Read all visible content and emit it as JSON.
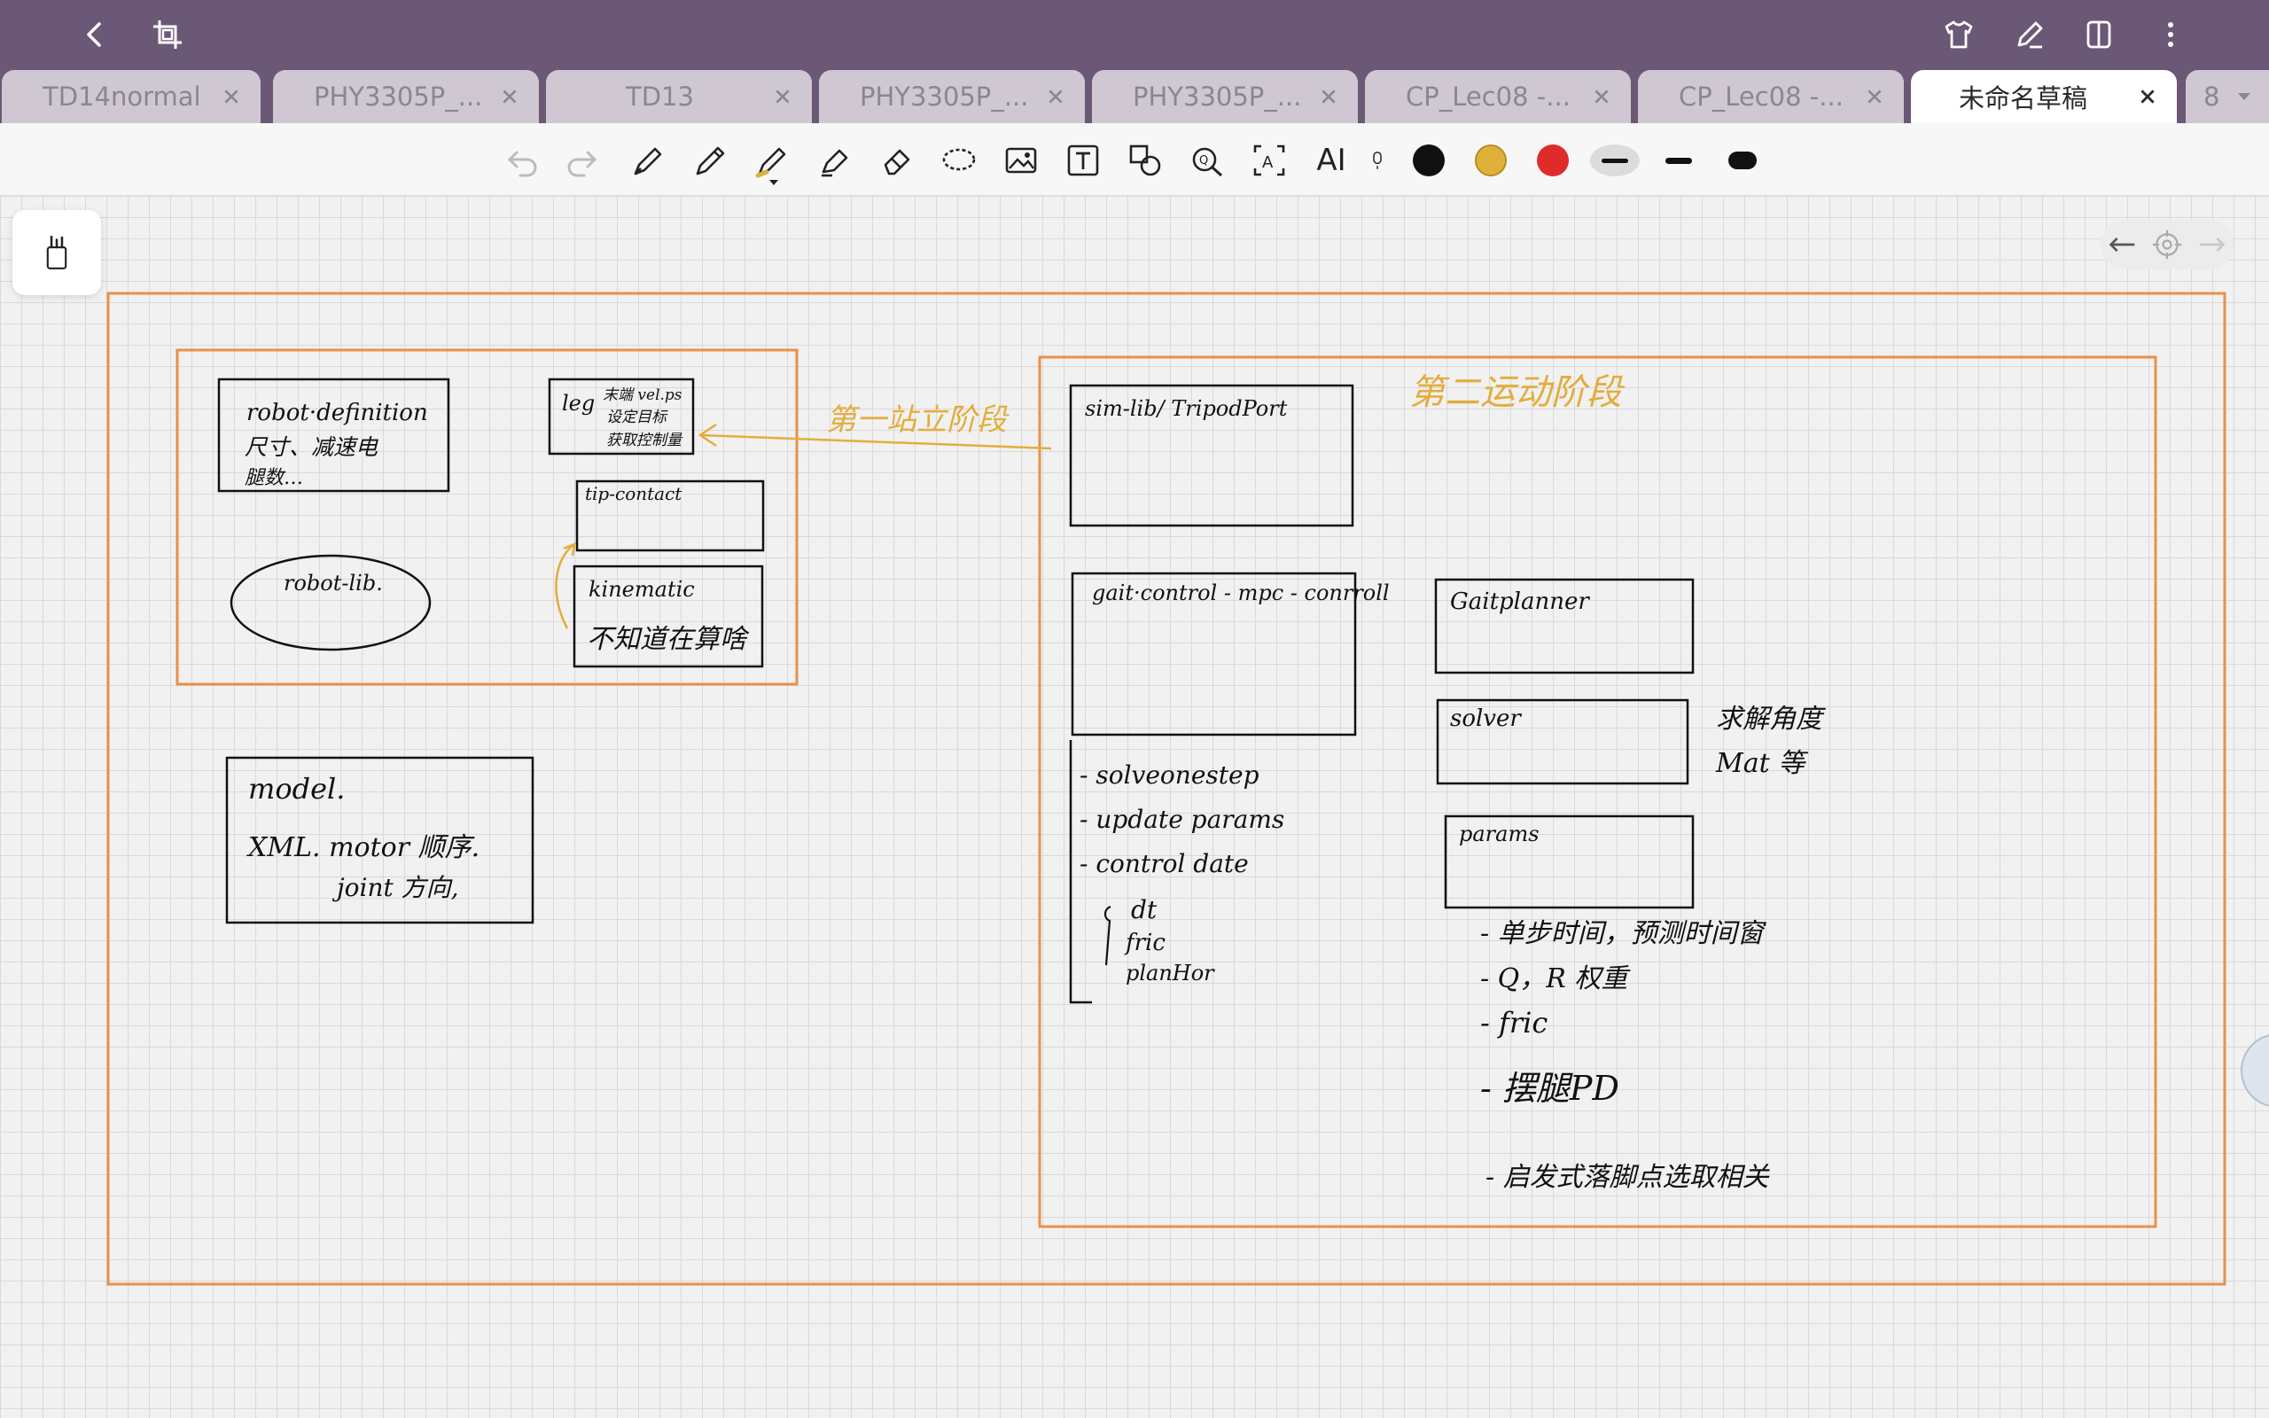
{
  "tabs": [
    {
      "label": "TD14normal",
      "active": false
    },
    {
      "label": "PHY3305P_...",
      "active": false
    },
    {
      "label": "TD13",
      "active": false
    },
    {
      "label": "PHY3305P_...",
      "active": false
    },
    {
      "label": "PHY3305P_...",
      "active": false
    },
    {
      "label": "CP_Lec08 -...",
      "active": false
    },
    {
      "label": "CP_Lec08 -...",
      "active": false
    },
    {
      "label": "未命名草稿",
      "active": true
    }
  ],
  "tab_overflow": "8",
  "colors": {
    "titlebar": "#6b5876",
    "frame_orange": "#e8914a",
    "annotation_yellow": "#e3ad3c",
    "swatch_black": "#111111",
    "swatch_gold": "#e0b13a",
    "swatch_red": "#e02b2b"
  },
  "icons": {
    "back": "chevron-left-icon",
    "crop": "crop-icon",
    "shirt": "shirt-icon",
    "pen": "pen-edit-icon",
    "layout": "layout-icon",
    "more": "more-vertical-icon"
  },
  "toolbar": {
    "ai_label": "AI"
  },
  "notes": {
    "robot_definition": [
      "robot·definition",
      "尺寸、减速电",
      "腿数…"
    ],
    "leg_box": [
      "leg",
      "末端 vel.ps",
      "设定目标",
      "获取控制量"
    ],
    "tip_contact": "tip-contact",
    "kinematic": [
      "kinematic",
      "不知道在算啥"
    ],
    "robot_lib": "robot-lib.",
    "model": [
      "model.",
      "XML. motor 顺序.",
      "joint 方向,"
    ],
    "stage1": "第一站立阶段",
    "stage2": "第二运动阶段",
    "sim_lib": "sim-lib/ TripodPort",
    "gait_control": "gait·control - mpc - conrroll",
    "gait_list": [
      "- solveonestep",
      "- update params",
      "- control date"
    ],
    "gait_sublist": [
      "dt",
      "fric",
      "planHor"
    ],
    "gaitplanner": "Gaitplanner",
    "solver": "solver",
    "solver_note": [
      "求解角度",
      "Mat 等"
    ],
    "params": "params",
    "params_list": [
      "- 单步时间，预测时间窗",
      "- Q，R 权重",
      "- fric",
      "- 摆腿PD",
      "- 启发式落脚点选取相关"
    ]
  }
}
